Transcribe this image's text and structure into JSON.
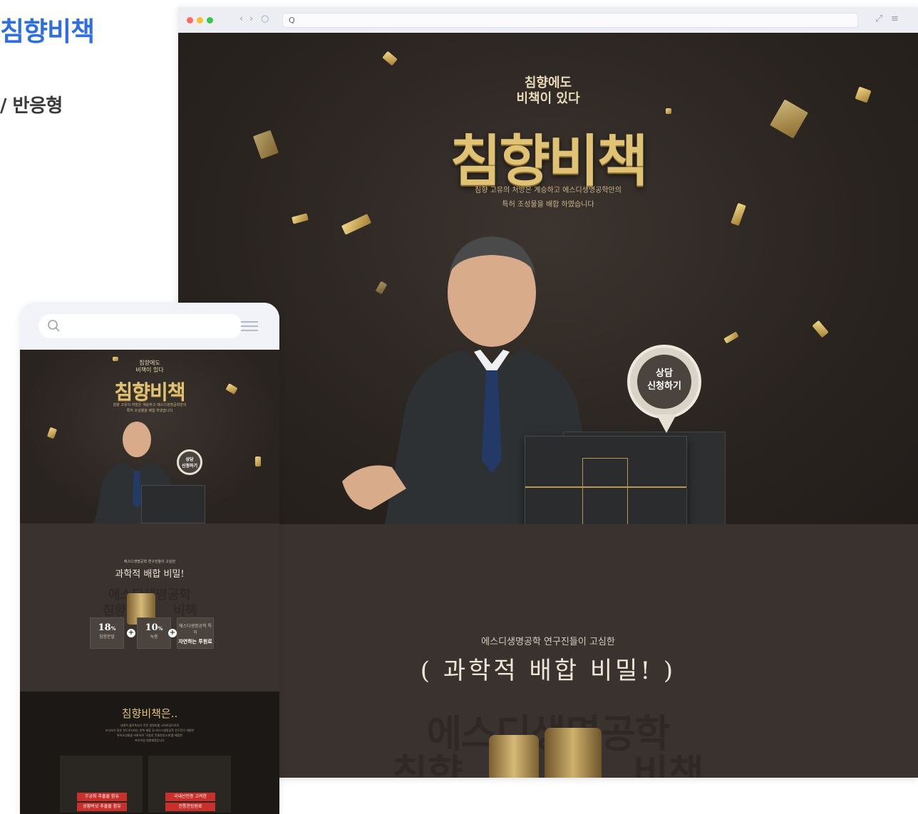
{
  "page": {
    "title": "침향비책",
    "subtitle": "/ 반응형"
  },
  "desktop": {
    "url": "Q",
    "hero": {
      "tagline": [
        "침향에도",
        "비책이 있다"
      ],
      "brand": "침향비책",
      "description": [
        "침향 고유의 처방은 계승하고 에스디생명공학만의",
        "특허 조성물을 배합 하였습니다"
      ],
      "cta": [
        "상담",
        "신청하기"
      ]
    },
    "section2": {
      "small": "에스디생명공학 연구진들이 고심한",
      "big": "과학적 배합 비밀!",
      "ghost_line1": "에스디생명공학",
      "ghost_line2": "침향 비책"
    }
  },
  "mobile": {
    "hero": {
      "tagline": [
        "침향에도",
        "비책이 있다"
      ],
      "brand": "침향비책",
      "description": [
        "침향 고유의 처방은 계승하고 에스디생명공학만의",
        "특허 조성물을 배합 하였습니다"
      ],
      "cta": [
        "상담",
        "신청하기"
      ]
    },
    "section2": {
      "small": "에스디생명공학 연구진들이 고심한",
      "big": "과학적 배합 비밀!",
      "ghost_line1": "에스디생명공학",
      "ghost_line2": "침향 비책"
    },
    "stats": [
      {
        "value": "18",
        "unit": "%",
        "label": "침향분말"
      },
      {
        "value": "10",
        "unit": "%",
        "label": "녹용"
      },
      {
        "value": "",
        "unit": "",
        "label": "에스디생명공학 특허",
        "extra": "자연하는 투원료"
      }
    ],
    "section3": {
      "heading": "침향비책은..",
      "lines": [
        "세계적 블로톡지가 작된 생명비를 고려보감으로의",
        "조사보가 맞은 반도로서하는 한복 배합 및 에스디생명공학 연구진이 개발한",
        "특허조성물을 비롯하여 '귀중한 전통한방소재'를 배합한",
        "프리미엄 침향제품입니다"
      ],
      "badges": [
        {
          "top": "무궁화 추출물 함유",
          "bottom": "상황버섯 추출물 함유"
        },
        {
          "top": "국내산인증 고려한",
          "bottom": "전통한방원료"
        }
      ]
    }
  },
  "colors": {
    "accent_blue": "#2f6ee0",
    "dark_brown": "#2a2420",
    "mid_brown": "#3a322e",
    "gold": "#e0c275",
    "badge_red": "#c9302c"
  },
  "icons": [
    "search-icon",
    "menu-icon",
    "back-icon",
    "forward-icon",
    "reload-icon",
    "expand-icon"
  ]
}
